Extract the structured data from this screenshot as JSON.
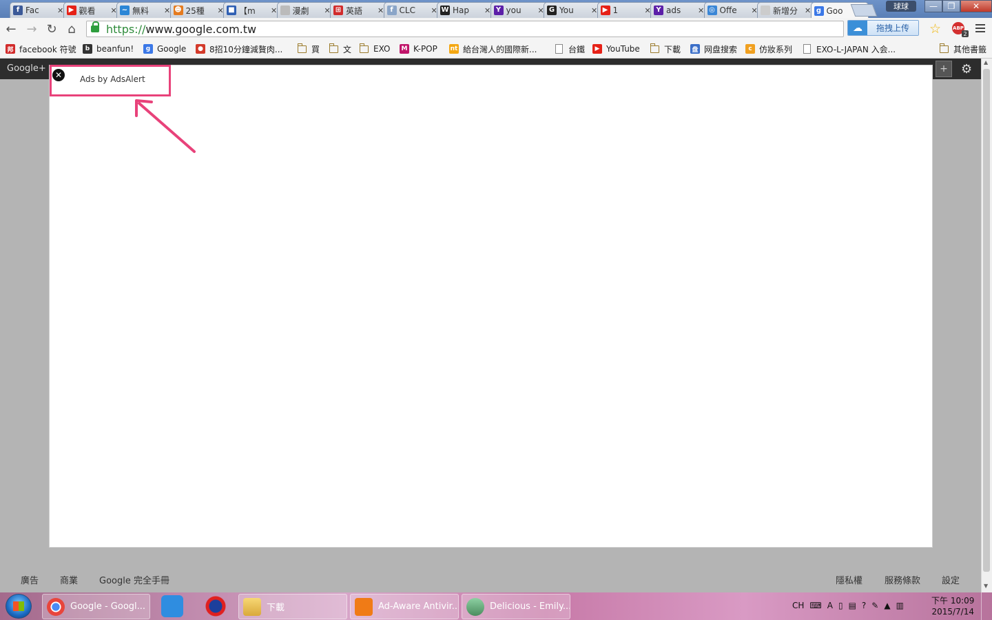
{
  "tabs": [
    {
      "label": "Fac",
      "icon": "facebook-icon",
      "color": "#3b5998",
      "glyph": "f"
    },
    {
      "label": "觀看",
      "icon": "youtube-icon",
      "color": "#e62117",
      "glyph": "▶"
    },
    {
      "label": "無料",
      "icon": "chart-icon",
      "color": "#2b86d6",
      "glyph": "~"
    },
    {
      "label": "25種",
      "icon": "face-icon",
      "color": "#e57b1f",
      "glyph": "☻"
    },
    {
      "label": "【m",
      "icon": "chat-icon",
      "color": "#2f5fb3",
      "glyph": "■"
    },
    {
      "label": "漫劇",
      "icon": "page-icon",
      "color": "#bbbbbb",
      "glyph": ""
    },
    {
      "label": "英語",
      "icon": "grid-icon",
      "color": "#d12b2b",
      "glyph": "⊞"
    },
    {
      "label": "CLC",
      "icon": "facebook-icon",
      "color": "#8aa5c8",
      "glyph": "f"
    },
    {
      "label": "Hap",
      "icon": "wave-icon",
      "color": "#222222",
      "glyph": "W"
    },
    {
      "label": "you",
      "icon": "yahoo-icon",
      "color": "#5c1fa8",
      "glyph": "Y"
    },
    {
      "label": "You",
      "icon": "gfriend-icon",
      "color": "#222222",
      "glyph": "G"
    },
    {
      "label": "1",
      "icon": "youtube-icon",
      "color": "#e62117",
      "glyph": "▶"
    },
    {
      "label": "ads",
      "icon": "yahoo-icon",
      "color": "#5c1fa8",
      "glyph": "Y"
    },
    {
      "label": "Offe",
      "icon": "globe-icon",
      "color": "#3a86d6",
      "glyph": "◎"
    },
    {
      "label": "新增分",
      "icon": "blank-icon",
      "color": "#cccccc",
      "glyph": ""
    },
    {
      "label": "Goo",
      "icon": "google-icon",
      "color": "#3b78e7",
      "glyph": "g"
    }
  ],
  "window": {
    "user": "球球",
    "minimize": "—",
    "maximize": "❐",
    "close": "✕"
  },
  "address": {
    "scheme": "https://",
    "host": "www.google.com.tw"
  },
  "upload_button": "拖拽上传",
  "bookmarks": [
    {
      "label": "facebook 符號",
      "kind": "icon",
      "color": "#d12b2b",
      "glyph": "邦"
    },
    {
      "label": "beanfun!",
      "kind": "icon",
      "color": "#333333",
      "glyph": "b"
    },
    {
      "label": "Google",
      "kind": "icon",
      "color": "#3b78e7",
      "glyph": "g"
    },
    {
      "label": "8招10分鐘減贅肉...",
      "kind": "icon",
      "color": "#d33a2a",
      "glyph": "●"
    },
    {
      "label": "買",
      "kind": "folder"
    },
    {
      "label": "文",
      "kind": "folder"
    },
    {
      "label": "EXO",
      "kind": "folder"
    },
    {
      "label": "K-POP",
      "kind": "icon",
      "color": "#c0156a",
      "glyph": "M"
    },
    {
      "label": "給台灣人的國際新...",
      "kind": "icon",
      "color": "#f4a712",
      "glyph": "nt"
    },
    {
      "label": "台鐵",
      "kind": "page"
    },
    {
      "label": "YouTube",
      "kind": "icon",
      "color": "#e62117",
      "glyph": "▶"
    },
    {
      "label": "下載",
      "kind": "folder"
    },
    {
      "label": "网盘搜索",
      "kind": "icon",
      "color": "#3a6ec8",
      "glyph": "盘"
    },
    {
      "label": "仿妝系列",
      "kind": "icon",
      "color": "#f0a020",
      "glyph": "c"
    },
    {
      "label": "EXO-L-JAPAN 入会...",
      "kind": "page"
    },
    {
      "label": "其他書籤",
      "kind": "folder"
    }
  ],
  "gbar": {
    "label": "Google+",
    "plus": "+"
  },
  "ad": {
    "close": "✕",
    "text": "Ads by AdsAlert",
    "accent": "#e8427a"
  },
  "footer": {
    "left": [
      "廣告",
      "商業",
      "Google 完全手冊"
    ],
    "right": [
      "隱私權",
      "服務條款",
      "設定"
    ]
  },
  "taskbar": {
    "chrome": "Google - Googl...",
    "folder": "下載",
    "adaware": "Ad-Aware Antivir...",
    "game": "Delicious - Emily...",
    "tray_lang": "CH",
    "time": "下午 10:09",
    "date": "2015/7/14"
  }
}
